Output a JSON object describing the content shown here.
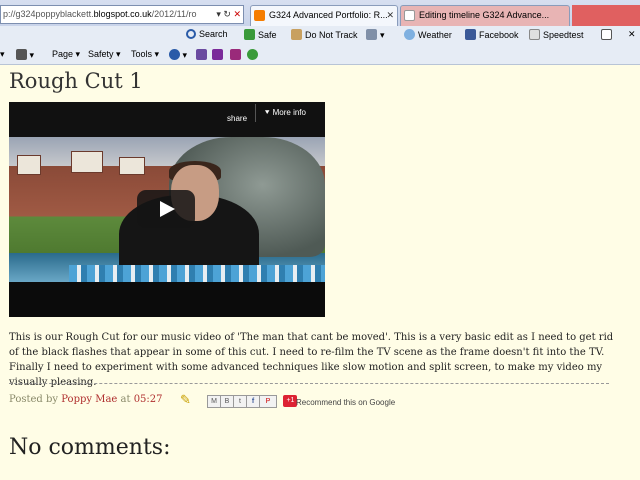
{
  "browser": {
    "address_prefix": "p://g324poppyblackett.",
    "address_domain": "blogspot.co.uk",
    "address_suffix": "/2012/11/ro",
    "tabs": [
      {
        "label": "G324 Advanced Portfolio: R..."
      },
      {
        "label": "Editing timeline G324 Advance..."
      }
    ],
    "toolbar1": {
      "search": "Search",
      "safe": "Safe",
      "dnt": "Do Not Track",
      "weather": "Weather",
      "facebook": "Facebook",
      "speedtest": "Speedtest"
    },
    "toolbar2": {
      "page": "Page",
      "safety": "Safety",
      "tools": "Tools"
    }
  },
  "post": {
    "title": "Rough Cut 1",
    "video": {
      "share": "share",
      "more_info": "More info"
    },
    "body": "This is our Rough Cut for our music video of 'The man that cant be moved'. This is a very basic edit as I need to get rid of the black flashes that appear in some of this cut. I need to re-film the TV scene as the frame doesn't fit into the TV. Finally I need to experiment with some advanced techniques like slow motion and split screen, to make my video my visually pleasing.",
    "footer": {
      "posted_by": "Posted by",
      "author": "Poppy Mae",
      "at": "at",
      "time": "05:27"
    },
    "share": {
      "plus_one": "+1",
      "recommend": "Recommend this on Google"
    }
  },
  "comments_heading": "No comments:"
}
